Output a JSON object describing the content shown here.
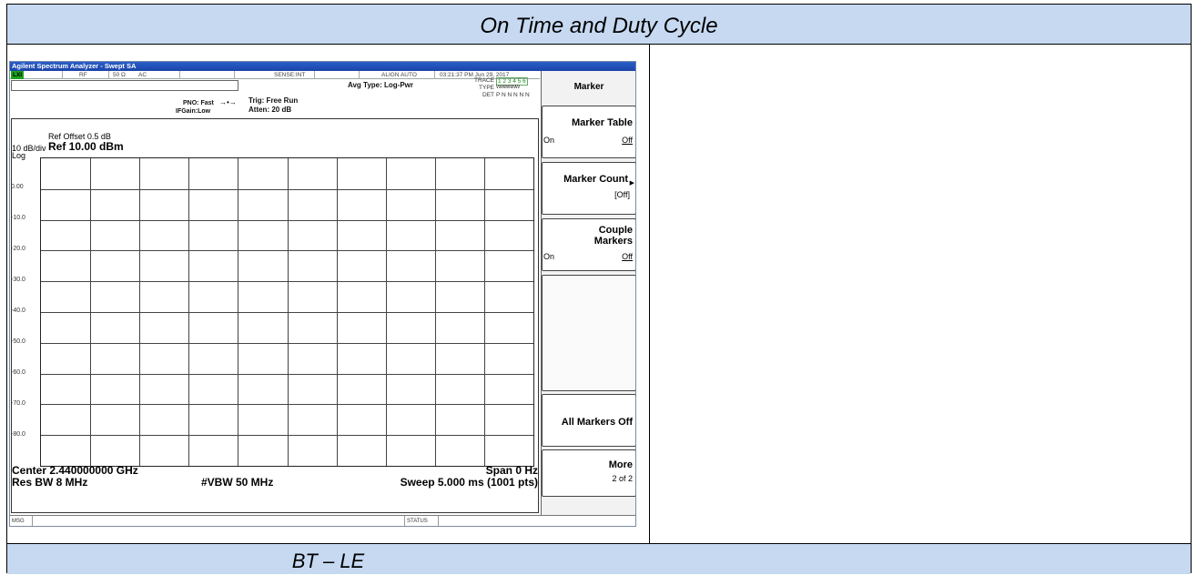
{
  "document": {
    "title": "On Time and Duty Cycle",
    "caption": "BT – LE"
  },
  "analyzer": {
    "window_title": "Agilent Spectrum Analyzer - Swept SA",
    "status": {
      "indicator": "LXI",
      "rf": "RF",
      "impedance": "50 Ω",
      "coupling": "AC",
      "sense": "SENSE:INT",
      "align": "ALIGN AUTO",
      "datetime": "03:21:37 PM Jun 29, 2017"
    },
    "avg_type": "Avg Type: Log-Pwr",
    "trace": {
      "trace_label": "TRACE",
      "trace_vals": "1 2 3 4 5 6",
      "type_label": "TYPE",
      "type_vals": "WWWWWW",
      "det_label": "DET",
      "det_vals": "P N N N N N"
    },
    "pno": "PNO: Fast",
    "ifgain": "IFGain:Low",
    "trig": "Trig: Free Run",
    "atten": "Atten: 20 dB",
    "ref_offset": "Ref Offset 0.5 dB",
    "scale": "10 dB/div",
    "ref_level": "Ref 10.00 dBm",
    "log_label": "Log",
    "y_ticks": [
      "0.00",
      "-10.0",
      "-20.0",
      "-30.0",
      "-40.0",
      "-50.0",
      "-60.0",
      "-70.0",
      "-80.0"
    ],
    "center": "Center 2.440000000 GHz",
    "span": "Span 0 Hz",
    "res_bw": "Res BW 8 MHz",
    "vbw": "#VBW 50 MHz",
    "sweep": "Sweep  5.000 ms (1001 pts)",
    "msg_label": "MSG",
    "status_label": "STATUS",
    "softkeys": {
      "menu_title": "Marker",
      "marker_table": {
        "label": "Marker Table",
        "on": "On",
        "off": "Off"
      },
      "marker_count": {
        "label": "Marker Count",
        "value": "[Off]"
      },
      "couple_markers": {
        "label1": "Couple",
        "label2": "Markers",
        "on": "On",
        "off": "Off"
      },
      "all_markers_off": "All Markers Off",
      "more": {
        "label": "More",
        "page": "2 of 2"
      }
    }
  }
}
